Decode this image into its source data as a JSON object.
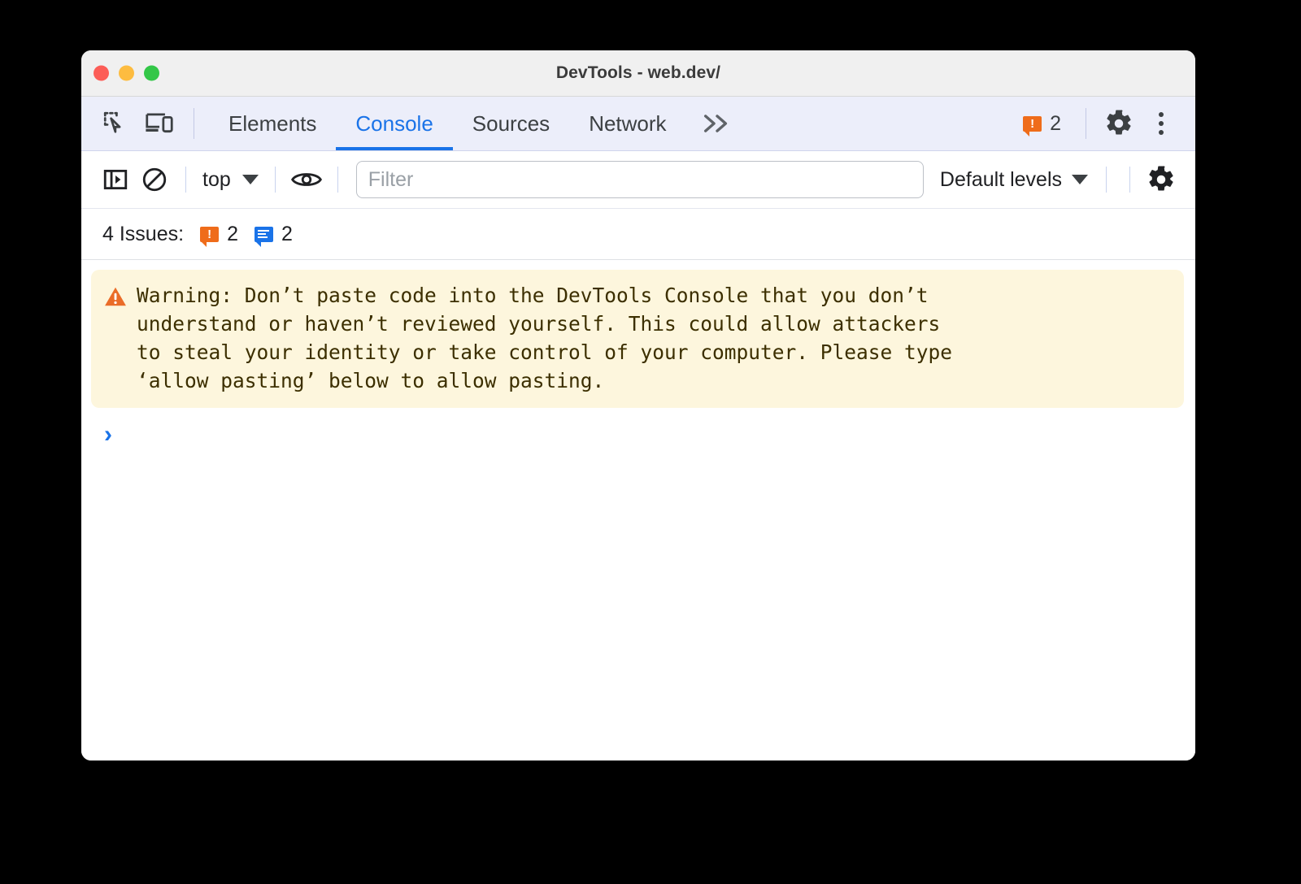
{
  "window": {
    "title": "DevTools - web.dev/",
    "traffic_lights": [
      "close",
      "minimize",
      "maximize"
    ]
  },
  "tabbar": {
    "inspect_icon": "inspect-element-icon",
    "device_icon": "device-toolbar-icon",
    "tabs": [
      {
        "label": "Elements",
        "active": false
      },
      {
        "label": "Console",
        "active": true
      },
      {
        "label": "Sources",
        "active": false
      },
      {
        "label": "Network",
        "active": false
      }
    ],
    "more_tabs_label": "»",
    "warning_badge": {
      "icon": "warning-bubble-icon",
      "count": "2"
    },
    "settings_icon": "gear-icon",
    "menu_icon": "kebab-menu-icon"
  },
  "console_toolbar": {
    "sidebar_toggle_icon": "console-sidebar-icon",
    "clear_console_icon": "clear-console-icon",
    "context_selector": {
      "value": "top"
    },
    "eye_icon": "live-expression-icon",
    "filter": {
      "placeholder": "Filter",
      "value": ""
    },
    "log_levels": {
      "value": "Default levels"
    },
    "settings_icon": "console-settings-gear-icon"
  },
  "issues_bar": {
    "label": "4 Issues:",
    "groups": [
      {
        "icon": "warning-bubble-icon",
        "color": "#ef6c1a",
        "count": "2"
      },
      {
        "icon": "info-bubble-icon",
        "color": "#1a73e8",
        "count": "2"
      }
    ]
  },
  "console": {
    "warning_message": {
      "icon": "warning-triangle-icon",
      "text": "Warning: Don’t paste code into the DevTools Console that you don’t\nunderstand or haven’t reviewed yourself. This could allow attackers\nto steal your identity or take control of your computer. Please type\n‘allow pasting’ below to allow pasting.",
      "background": "#fdf6dd"
    },
    "prompt": {
      "chevron": "›"
    }
  }
}
